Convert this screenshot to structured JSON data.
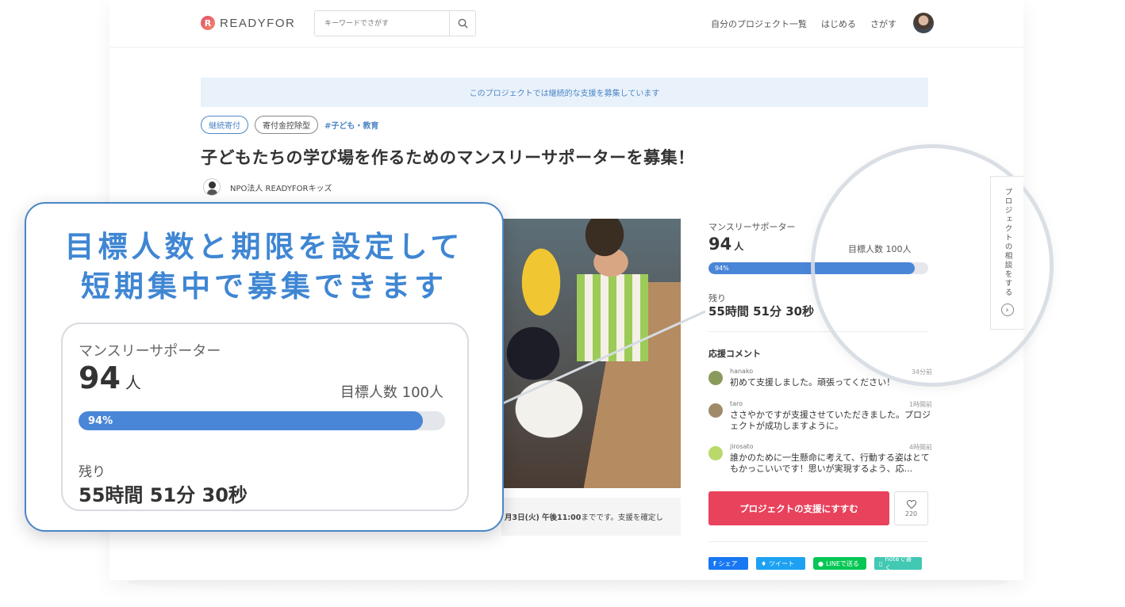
{
  "header": {
    "logo_text": "READYFOR",
    "logo_mark": "R",
    "search_placeholder": "キーワードでさがす",
    "nav": [
      "自分のプロジェクト一覧",
      "はじめる",
      "さがす"
    ]
  },
  "notice": "このプロジェクトでは継続的な支援を募集しています",
  "tags": [
    "継続寄付",
    "寄付金控除型"
  ],
  "hashtag": "#子ども・教育",
  "title": "子どもたちの学び場を作るためのマンスリーサポーターを募集！",
  "owner": "NPO法人 READYFORキッズ",
  "deadline": {
    "date": "月3日(火) 午後11:00",
    "suffix": "までです。支援を確定し"
  },
  "stats": {
    "supporters_label": "マンスリーサポーター",
    "supporters": "94",
    "unit": "人",
    "goal": "目標人数 100人",
    "progress_text": "94%",
    "progress": 0.94,
    "remaining_label": "残り",
    "remaining": "55時間 51分 30秒"
  },
  "comments": {
    "title": "応援コメント",
    "items": [
      {
        "name": "hanako",
        "time": "34分前",
        "text": "初めて支援しました。頑張ってください！",
        "color": "#8a9a5b"
      },
      {
        "name": "taro",
        "time": "1時間前",
        "text": "ささやかですが支援させていただきました。プロジェクトが成功しますように。",
        "color": "#a08a6a"
      },
      {
        "name": "jirosato",
        "time": "4時間前",
        "text": "誰かのために一生懸命に考えて、行動する姿はとてもかっこいいです！思いが実現するよう、応...",
        "color": "#b9d96a"
      }
    ]
  },
  "support_button": "プロジェクトの支援にすすむ",
  "likes": "220",
  "share": {
    "facebook": "シェア",
    "twitter": "ツイート",
    "line": "LINEで送る",
    "note": "noteで書く"
  },
  "side_tab": "プロジェクトの相談をする",
  "callout": {
    "line1": "目標人数と期限を設定して",
    "line2": "短期集中で募集できます"
  },
  "colors": {
    "accent_blue": "#4a86d8",
    "support_red": "#e8425c",
    "callout_blue": "#3f86d3"
  }
}
